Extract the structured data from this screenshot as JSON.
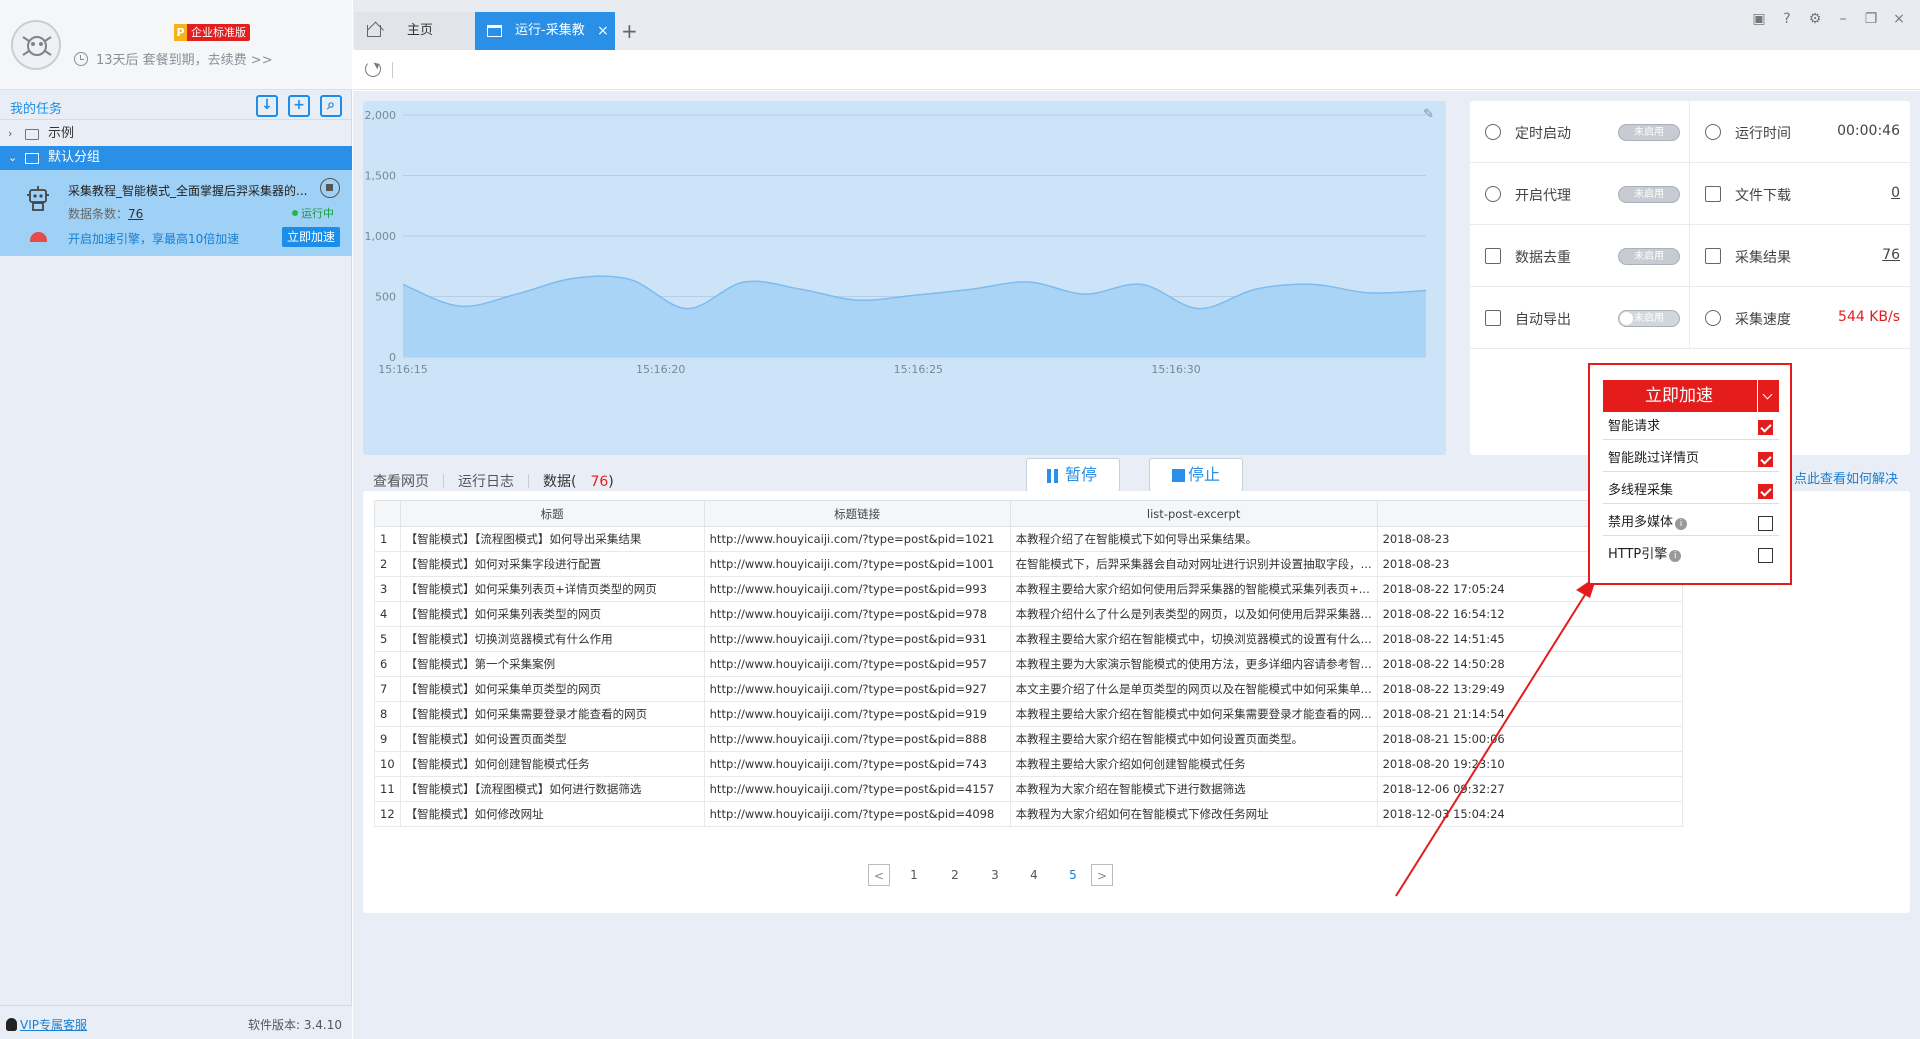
{
  "profile": {
    "edition": "企业标准版",
    "edition_letter": "P",
    "expire_text": "13天后 套餐到期，去续费 >>"
  },
  "sidebar": {
    "title": "我的任务",
    "groups": [
      {
        "label": "示例",
        "active": false
      },
      {
        "label": "默认分组",
        "active": true
      }
    ],
    "task": {
      "name": "采集教程_智能模式_全面掌握后羿采集器的...",
      "count_label": "数据条数：",
      "count_value": "76",
      "status": "运行中",
      "accel_text": "开启加速引擎，享最高10倍加速",
      "accel_button": "立即加速"
    },
    "footer": {
      "vip": "VIP专属客服",
      "version": "软件版本: 3.4.10"
    }
  },
  "tabs": {
    "home": "主页",
    "run": "运行-采集教...",
    "close": "×",
    "add": "+"
  },
  "chart_data": {
    "type": "area",
    "x_ticks": [
      "15:16:15",
      "15:16:20",
      "15:16:25",
      "15:16:30"
    ],
    "y_ticks": [
      "2,000",
      "1,500",
      "1,000",
      "500",
      "0"
    ],
    "ylim": [
      0,
      2000
    ],
    "grid": true,
    "values": [
      600,
      420,
      520,
      650,
      640,
      400,
      620,
      560,
      470,
      510,
      560,
      620,
      520,
      600,
      400,
      560,
      600,
      530,
      550
    ]
  },
  "stats": {
    "timer": {
      "label": "定时启动",
      "toggle": "未启用"
    },
    "runtime": {
      "label": "运行时间",
      "value": "00:00:46"
    },
    "proxy": {
      "label": "开启代理",
      "toggle": "未启用"
    },
    "download": {
      "label": "文件下载",
      "value": "0"
    },
    "dedupe": {
      "label": "数据去重",
      "toggle": "未启用"
    },
    "results": {
      "label": "采集结果",
      "value": "76"
    },
    "export": {
      "label": "自动导出",
      "toggle": "未启用"
    },
    "speed": {
      "label": "采集速度",
      "value": "544 KB/s"
    }
  },
  "actions": {
    "view_page": "查看网页",
    "run_log": "运行日志",
    "data_label": "数据(",
    "data_count": "76",
    "data_close": ")",
    "pause": "暂停",
    "stop": "停止",
    "hint": "? 点此查看如何解决"
  },
  "table": {
    "headers": [
      "",
      "标题",
      "标题链接",
      "list-post-excerpt",
      ""
    ],
    "rows": [
      [
        "1",
        "【智能模式】【流程图模式】如何导出采集结果",
        "http://www.houyicaiji.com/?type=post&pid=1021",
        "本教程介绍了在智能模式下如何导出采集结果。",
        "2018-08-23"
      ],
      [
        "2",
        "【智能模式】如何对采集字段进行配置",
        "http://www.houyicaiji.com/?type=post&pid=1001",
        "在智能模式下，后羿采集器会自动对网址进行识别并设置抽取字段，...",
        "2018-08-23"
      ],
      [
        "3",
        "【智能模式】如何采集列表页+详情页类型的网页",
        "http://www.houyicaiji.com/?type=post&pid=993",
        "本教程主要给大家介绍如何使用后羿采集器的智能模式采集列表页+...",
        "2018-08-22 17:05:24"
      ],
      [
        "4",
        "【智能模式】如何采集列表类型的网页",
        "http://www.houyicaiji.com/?type=post&pid=978",
        "本教程介绍什么了什么是列表类型的网页，以及如何使用后羿采集器...",
        "2018-08-22 16:54:12"
      ],
      [
        "5",
        "【智能模式】切换浏览器模式有什么作用",
        "http://www.houyicaiji.com/?type=post&pid=931",
        "本教程主要给大家介绍在智能模式中，切换浏览器模式的设置有什么...",
        "2018-08-22 14:51:45"
      ],
      [
        "6",
        "【智能模式】第一个采集案例",
        "http://www.houyicaiji.com/?type=post&pid=957",
        "本教程主要为大家演示智能模式的使用方法，更多详细内容请参考智...",
        "2018-08-22 14:50:28"
      ],
      [
        "7",
        "【智能模式】如何采集单页类型的网页",
        "http://www.houyicaiji.com/?type=post&pid=927",
        "本文主要介绍了什么是单页类型的网页以及在智能模式中如何采集单...",
        "2018-08-22 13:29:49"
      ],
      [
        "8",
        "【智能模式】如何采集需要登录才能查看的网页",
        "http://www.houyicaiji.com/?type=post&pid=919",
        "本教程主要给大家介绍在智能模式中如何采集需要登录才能查看的网...",
        "2018-08-21 21:14:54"
      ],
      [
        "9",
        "【智能模式】如何设置页面类型",
        "http://www.houyicaiji.com/?type=post&pid=888",
        "本教程主要给大家介绍在智能模式中如何设置页面类型。",
        "2018-08-21 15:00:06"
      ],
      [
        "10",
        "【智能模式】如何创建智能模式任务",
        "http://www.houyicaiji.com/?type=post&pid=743",
        "本教程主要给大家介绍如何创建智能模式任务",
        "2018-08-20 19:23:10"
      ],
      [
        "11",
        "【智能模式】【流程图模式】如何进行数据筛选",
        "http://www.houyicaiji.com/?type=post&pid=4157",
        "本教程为大家介绍在智能模式下进行数据筛选",
        "2018-12-06 09:32:27"
      ],
      [
        "12",
        "【智能模式】如何修改网址",
        "http://www.houyicaiji.com/?type=post&pid=4098",
        "本教程为大家介绍如何在智能模式下修改任务网址",
        "2018-12-03 15:04:24"
      ]
    ]
  },
  "pager": {
    "prev": "<",
    "pages": [
      "1",
      "2",
      "3",
      "4",
      "5"
    ],
    "current": "5",
    "next": ">"
  },
  "accelerate": {
    "button": "立即加速",
    "options": [
      {
        "label": "智能请求",
        "checked": true,
        "info": false
      },
      {
        "label": "智能跳过详情页",
        "checked": true,
        "info": false
      },
      {
        "label": "多线程采集",
        "checked": true,
        "info": false
      },
      {
        "label": "禁用多媒体",
        "checked": false,
        "info": true
      },
      {
        "label": "HTTP引擎",
        "checked": false,
        "info": true
      }
    ],
    "info_mark": "i"
  },
  "colors": {
    "accent": "#2a8fe6",
    "alert": "#e51c1c",
    "chart_fill": "#a9d4f5",
    "chart_line": "#7cbcef"
  }
}
